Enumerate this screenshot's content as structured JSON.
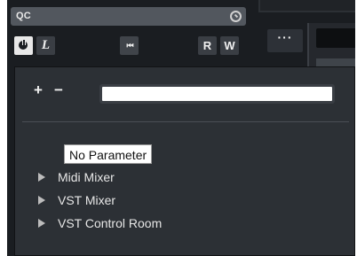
{
  "quick_controls": {
    "title": "QC",
    "link_icon": "link-circle-icon",
    "power_icon": "power-icon",
    "learn_label": "L",
    "rewind_label": "⏮",
    "read_label": "R",
    "write_label": "W"
  },
  "right_panel": {
    "more_label": "···"
  },
  "parameter_popup": {
    "add_label": "+",
    "remove_label": "−",
    "search_value": "",
    "tooltip": "No Parameter",
    "tree_items": [
      {
        "label": "Midi Mixer",
        "expand_icon": "triangle-right-icon"
      },
      {
        "label": "VST Mixer",
        "expand_icon": "triangle-right-icon"
      },
      {
        "label": "VST Control Room",
        "expand_icon": "triangle-right-icon"
      }
    ]
  }
}
